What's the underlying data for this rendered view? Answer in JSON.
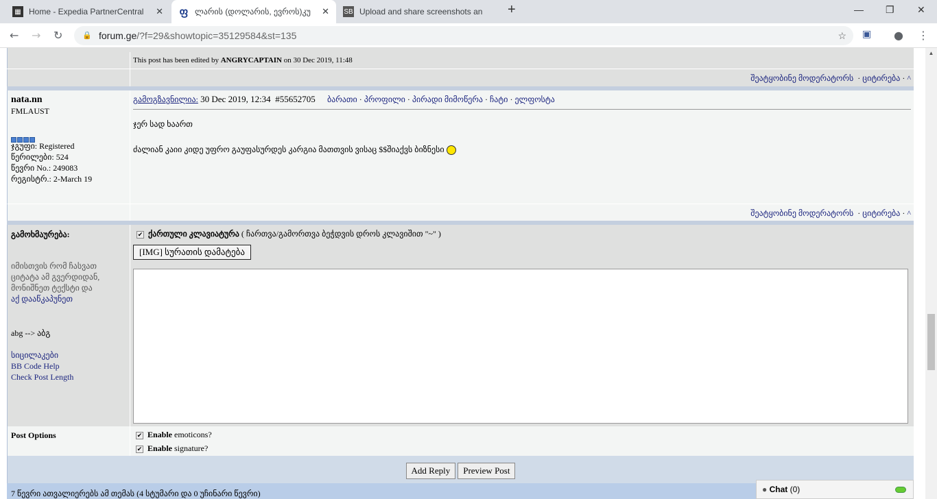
{
  "browser": {
    "tabs": [
      {
        "title": "Home - Expedia PartnerCentral",
        "icon": "building-icon"
      },
      {
        "title": "ლარის (დოლარის, ევროს)კუ",
        "icon": "forum-ge-icon",
        "active": true
      },
      {
        "title": "Upload and share screenshots an",
        "icon": "SB"
      }
    ],
    "url_domain": "forum.ge",
    "url_path": "/?f=29&showtopic=35129584&st=135"
  },
  "edited_notice": {
    "prefix": "This post has been edited by",
    "user": "ANGRYCAPTAIN",
    "suffix": "on 30 Dec 2019, 11:48"
  },
  "post_actions": {
    "report": "შეატყობინე მოდერატორს",
    "quote": "ციტირება",
    "top": "^"
  },
  "post": {
    "username": "nata.nn",
    "title": "FMLAUST",
    "group": "ჯგუფი: Registered",
    "posts": "წერილები: 524",
    "member_no": "წევრი No.: 249083",
    "registered": "რეგისტრ.: 2-March 19",
    "posted_label": "გამოგზავნილია:",
    "date": "30 Dec 2019, 12:34",
    "post_id": "#55652705",
    "links": [
      "ბარათი",
      "პროფილი",
      "პირადი მიმოწერა",
      "ჩატი",
      "ელფოსტა"
    ],
    "line1": "ჯერ სად ხაართ",
    "line2": "ძალიან კაიი კიდე უფრო გაუფასურდეს კარგია მათთვის ვისაც $$შიაქვს ბიზნესი"
  },
  "reply": {
    "label": "გამოხმაურება:",
    "kbd_label": "ქართული კლავიატურა",
    "kbd_hint": "( ჩართვა/გამორთვა ბეჭდვის დროს კლავიშით \"~\" )",
    "img_button": "[IMG] სურათის დამატება",
    "quote_help": "იმისთვის რომ ჩასვათ ციტატა ამ გვერდიდან, მონიშნეთ ტექსტი და",
    "quote_link": "აქ დააწკაპუნეთ",
    "translit": "abg --> აბგ",
    "smilies": "სიცილაკები",
    "bbcode": "BB Code Help",
    "check_length": "Check Post Length",
    "textarea_value": ""
  },
  "options": {
    "label": "Post Options",
    "emoticons_bold": "Enable",
    "emoticons": "emoticons?",
    "signature_bold": "Enable",
    "signature": "signature?"
  },
  "buttons": {
    "add_reply": "Add Reply",
    "preview": "Preview Post"
  },
  "footer": "7 წევრი ათვალიერებს ამ თემას (4 სტუმარი და 0 უჩინარი წევრი)",
  "chat": {
    "label": "Chat",
    "count": "(0)"
  }
}
